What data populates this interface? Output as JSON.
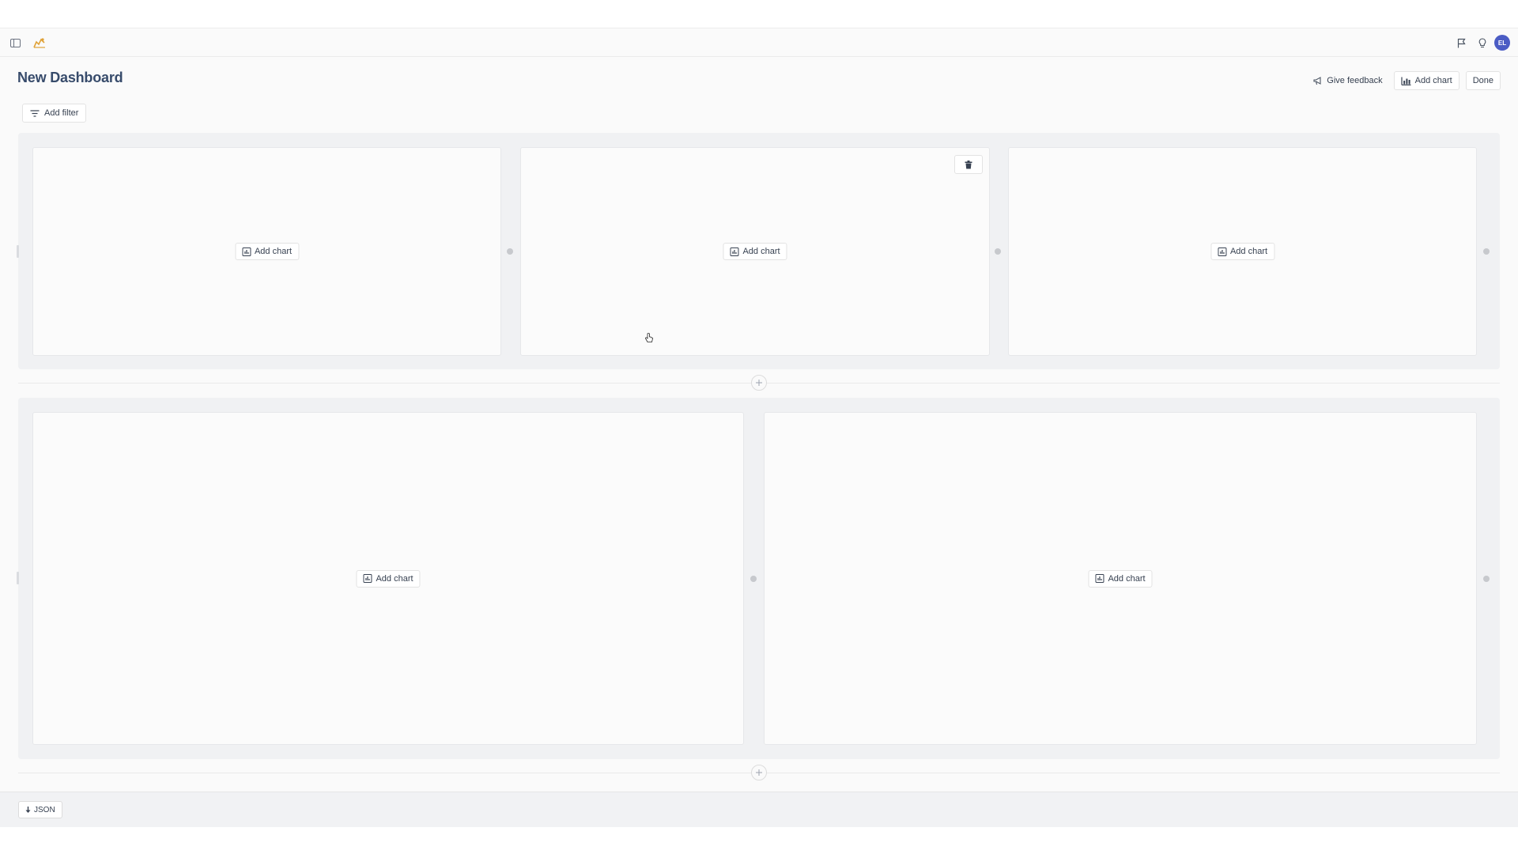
{
  "dashboard": {
    "title": "New Dashboard"
  },
  "header": {
    "feedback_label": "Give feedback",
    "add_chart_label": "Add chart",
    "done_label": "Done"
  },
  "avatar": {
    "initials": "EL",
    "color": "#4b5cc4"
  },
  "filter": {
    "add_label": "Add filter"
  },
  "rows": [
    {
      "tiles": [
        {
          "add_label": "Add chart"
        },
        {
          "add_label": "Add chart"
        },
        {
          "add_label": "Add chart"
        }
      ]
    },
    {
      "tiles": [
        {
          "add_label": "Add chart"
        },
        {
          "add_label": "Add chart"
        }
      ]
    }
  ],
  "footer": {
    "json_label": "JSON"
  },
  "icons": {
    "sidebar_toggle": "sidebar-toggle-icon",
    "logo": "hog-logo-icon",
    "flag": "flag-icon",
    "lightbulb": "lightbulb-icon",
    "megaphone": "megaphone-icon",
    "chart": "bar-chart-icon",
    "filter": "filter-icon",
    "trash": "trash-icon",
    "plus": "plus-icon",
    "download": "download-icon"
  },
  "colors": {
    "accent": "#4b5cc4",
    "title": "#374b6b",
    "logo": "#e0a238"
  }
}
